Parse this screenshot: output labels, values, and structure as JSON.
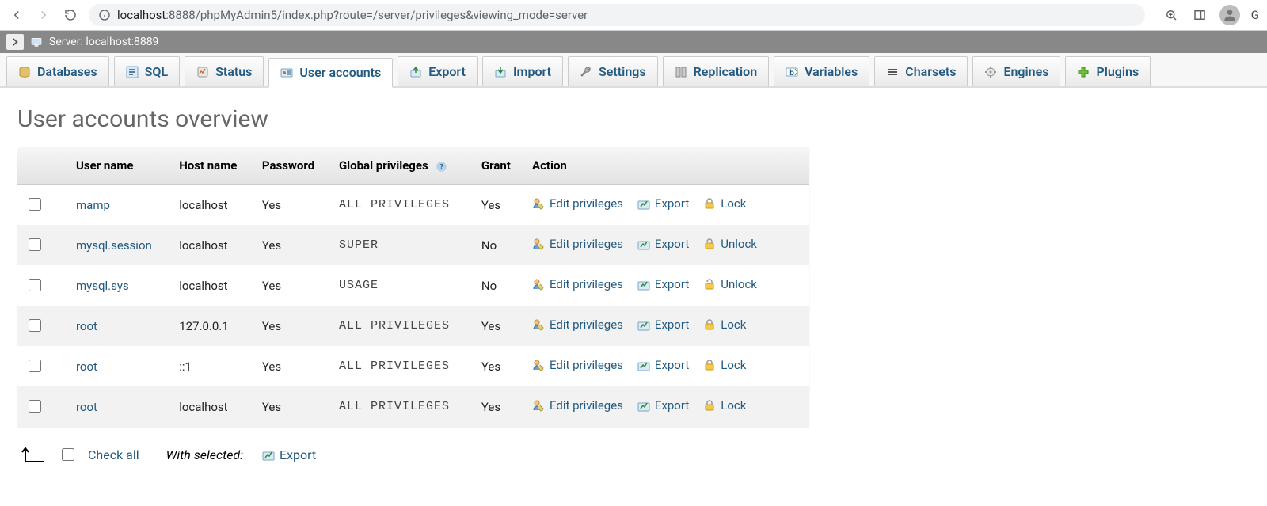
{
  "browser": {
    "url_host": "localhost",
    "url_port": ":8888",
    "url_path": "/phpMyAdmin5/index.php?route=/server/privileges&viewing_mode=server",
    "profile_initial": "G"
  },
  "server_bar": {
    "label": "Server: localhost:8889"
  },
  "tabs": [
    {
      "label": "Databases",
      "icon": "databases",
      "active": false
    },
    {
      "label": "SQL",
      "icon": "sql",
      "active": false
    },
    {
      "label": "Status",
      "icon": "status",
      "active": false
    },
    {
      "label": "User accounts",
      "icon": "users",
      "active": true
    },
    {
      "label": "Export",
      "icon": "export",
      "active": false
    },
    {
      "label": "Import",
      "icon": "import",
      "active": false
    },
    {
      "label": "Settings",
      "icon": "wrench",
      "active": false
    },
    {
      "label": "Replication",
      "icon": "replication",
      "active": false
    },
    {
      "label": "Variables",
      "icon": "variables",
      "active": false
    },
    {
      "label": "Charsets",
      "icon": "charsets",
      "active": false
    },
    {
      "label": "Engines",
      "icon": "engines",
      "active": false
    },
    {
      "label": "Plugins",
      "icon": "plugins",
      "active": false
    }
  ],
  "page": {
    "title": "User accounts overview",
    "columns": {
      "checkbox": "",
      "user": "User name",
      "host": "Host name",
      "password": "Password",
      "privileges": "Global privileges",
      "grant": "Grant",
      "action": "Action"
    },
    "action_labels": {
      "edit": "Edit privileges",
      "export": "Export",
      "lock": "Lock",
      "unlock": "Unlock"
    },
    "rows": [
      {
        "user": "mamp",
        "host": "localhost",
        "password": "Yes",
        "privileges": "ALL PRIVILEGES",
        "grant": "Yes",
        "lock": "Lock"
      },
      {
        "user": "mysql.session",
        "host": "localhost",
        "password": "Yes",
        "privileges": "SUPER",
        "grant": "No",
        "lock": "Unlock"
      },
      {
        "user": "mysql.sys",
        "host": "localhost",
        "password": "Yes",
        "privileges": "USAGE",
        "grant": "No",
        "lock": "Unlock"
      },
      {
        "user": "root",
        "host": "127.0.0.1",
        "password": "Yes",
        "privileges": "ALL PRIVILEGES",
        "grant": "Yes",
        "lock": "Lock"
      },
      {
        "user": "root",
        "host": "::1",
        "password": "Yes",
        "privileges": "ALL PRIVILEGES",
        "grant": "Yes",
        "lock": "Lock"
      },
      {
        "user": "root",
        "host": "localhost",
        "password": "Yes",
        "privileges": "ALL PRIVILEGES",
        "grant": "Yes",
        "lock": "Lock"
      }
    ],
    "footer": {
      "check_all": "Check all",
      "with_selected": "With selected:",
      "export": "Export"
    }
  }
}
